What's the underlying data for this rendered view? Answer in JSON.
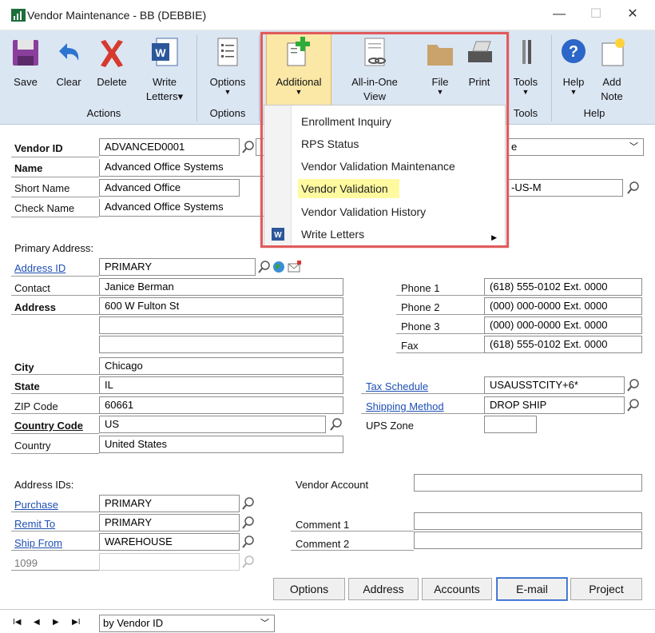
{
  "window": {
    "title": "Vendor Maintenance  -  BB (DEBBIE)",
    "minimize": "—",
    "maximize": "☐",
    "close": "✕"
  },
  "ribbon": {
    "buttons": {
      "save": "Save",
      "clear": "Clear",
      "delete": "Delete",
      "write": "Write",
      "letters": "Letters▾",
      "options": "Options",
      "additional": "Additional",
      "allinone1": "All-in-One",
      "allinone2": "View",
      "file": "File",
      "print": "Print",
      "tools": "Tools",
      "help": "Help",
      "add1": "Add",
      "add2": "Note"
    },
    "groups": {
      "actions": "Actions",
      "options": "Options",
      "tools": "Tools",
      "help": "Help"
    }
  },
  "menu": {
    "items": [
      "Enrollment Inquiry",
      "RPS Status",
      "Vendor Validation Maintenance",
      "Vendor Validation",
      "Vendor Validation History",
      "Write Letters"
    ]
  },
  "form": {
    "vendor_id_label": "Vendor ID",
    "vendor_id": "ADVANCED0001",
    "name_label": "Name",
    "name": "Advanced Office Systems",
    "short_name_label": "Short Name",
    "short_name": "Advanced Office",
    "check_name_label": "Check Name",
    "check_name": "Advanced Office Systems",
    "status_partial": "e",
    "class_partial": "-US-M",
    "primary_address_label": "Primary Address:",
    "address_id_label": "Address ID",
    "address_id": "PRIMARY",
    "contact_label": "Contact",
    "contact": "Janice Berman",
    "address_label": "Address",
    "address1": "600 W Fulton St",
    "address2": "",
    "address3": "",
    "city_label": "City",
    "city": "Chicago",
    "state_label": "State",
    "state": "IL",
    "zip_label": "ZIP Code",
    "zip": "60661",
    "country_code_label": "Country Code",
    "country_code": "US",
    "country_label": "Country",
    "country": "United States",
    "phone1_label": "Phone 1",
    "phone1": "(618) 555-0102  Ext. 0000",
    "phone2_label": "Phone 2",
    "phone2": "(000) 000-0000  Ext. 0000",
    "phone3_label": "Phone 3",
    "phone3": "(000) 000-0000  Ext. 0000",
    "fax_label": "Fax",
    "fax": "(618) 555-0102  Ext. 0000",
    "tax_schedule_label": "Tax Schedule",
    "tax_schedule": "USAUSSTCITY+6*",
    "shipping_method_label": "Shipping Method",
    "shipping_method": "DROP SHIP",
    "ups_zone_label": "UPS Zone",
    "ups_zone": "",
    "address_ids_label": "Address IDs:",
    "purchase_label": "Purchase",
    "purchase": "PRIMARY",
    "remit_to_label": "Remit To",
    "remit_to": "PRIMARY",
    "ship_from_label": "Ship From",
    "ship_from": "WAREHOUSE",
    "n1099_label": "1099",
    "vendor_account_label": "Vendor Account",
    "vendor_account": "",
    "comment1_label": "Comment 1",
    "comment1": "",
    "comment2_label": "Comment 2",
    "comment2": ""
  },
  "buttons": {
    "options": "Options",
    "address": "Address",
    "accounts": "Accounts",
    "email": "E-mail",
    "project": "Project"
  },
  "statusbar": {
    "nav_first": "I◀",
    "nav_prev": "◀",
    "nav_next": "▶",
    "nav_last": "▶I",
    "sort": "by Vendor ID"
  },
  "colors": {
    "ribbon_bg": "#dbe6f3",
    "highlight": "#fbe7a6",
    "menu_highlight": "#fffaa0",
    "frame_red": "#e05b5b",
    "link": "#1e4fb4"
  }
}
